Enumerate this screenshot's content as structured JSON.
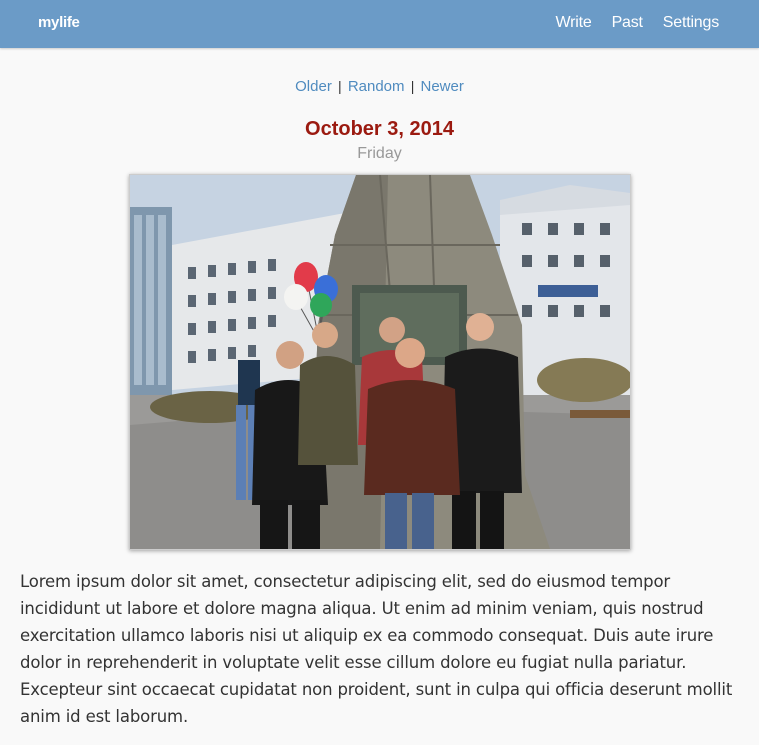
{
  "app": {
    "logo_text": "mylife"
  },
  "nav": {
    "items": [
      {
        "label": "Write"
      },
      {
        "label": "Past"
      },
      {
        "label": "Settings"
      }
    ]
  },
  "pager": {
    "older": "Older",
    "random": "Random",
    "newer": "Newer",
    "separator": "|"
  },
  "entry": {
    "date": "October 3, 2014",
    "weekday": "Friday",
    "photo_alt": "Photo attached to entry",
    "body": "Lorem ipsum dolor sit amet, consectetur adipiscing elit, sed do eiusmod tempor incididunt ut labore et dolore magna aliqua. Ut enim ad minim veniam, quis nostrud exercitation ullamco laboris nisi ut aliquip ex ea commodo consequat. Duis aute irure dolor in reprehenderit in voluptate velit esse cillum dolore eu fugiat nulla pariatur. Excepteur sint occaecat cupidatat non proident, sunt in culpa qui officia deserunt mollit anim id est laborum."
  },
  "colors": {
    "topbar": "#6b9bc7",
    "link": "#4f8bbf",
    "date": "#9b1a10",
    "weekday": "#999999",
    "background": "#f9f9f9"
  }
}
